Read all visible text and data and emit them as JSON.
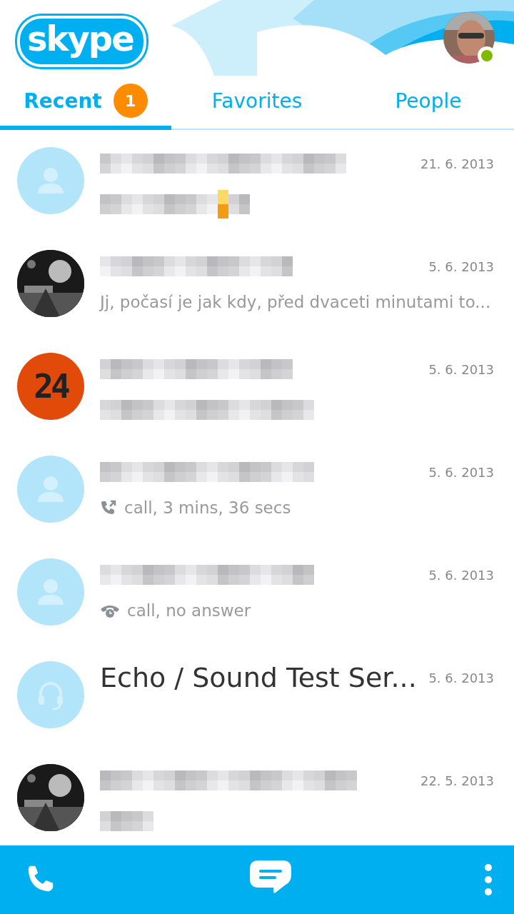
{
  "logo": {
    "text": "skype"
  },
  "profile": {
    "status_dot": {
      "color": "#7fba00"
    }
  },
  "tabs": [
    {
      "label": "Recent",
      "badge": "1",
      "selected": true
    },
    {
      "label": "Favorites",
      "selected": false
    },
    {
      "label": "People",
      "selected": false
    }
  ],
  "conversations": [
    {
      "avatar": {
        "kind": "placeholder"
      },
      "name": {
        "kind": "redacted"
      },
      "date": "21. 6. 2013",
      "message": {
        "kind": "redacted"
      }
    },
    {
      "name": {
        "kind": "redacted"
      },
      "date": "5. 6. 2013",
      "message": {
        "kind": "text",
        "text": "Jj, počasí je jak kdy, před dvaceti minutami to..."
      }
    },
    {
      "avatar": {
        "kind": "badge",
        "text": "24"
      },
      "name": {
        "kind": "redacted"
      },
      "date": "5. 6. 2013",
      "message": {
        "kind": "redacted"
      }
    },
    {
      "avatar": {
        "kind": "placeholder"
      },
      "name": {
        "kind": "redacted"
      },
      "date": "5. 6. 2013",
      "message": {
        "kind": "outgoing_call",
        "text": "call, 3 mins, 36 secs"
      }
    },
    {
      "avatar": {
        "kind": "placeholder"
      },
      "name": {
        "kind": "redacted"
      },
      "date": "5. 6. 2013",
      "message": {
        "kind": "missed_call",
        "text": "call, no answer"
      }
    },
    {
      "avatar": {
        "kind": "headset"
      },
      "name": {
        "kind": "text",
        "text": "Echo / Sound Test Ser..."
      },
      "date": "5. 6. 2013"
    },
    {
      "name": {
        "kind": "redacted"
      },
      "date": "22. 5. 2013",
      "message": {
        "kind": "redacted"
      }
    }
  ],
  "bottom_bar": {
    "buttons": [
      {
        "kind": "call"
      },
      {
        "kind": "chat"
      },
      {
        "kind": "more"
      }
    ]
  }
}
